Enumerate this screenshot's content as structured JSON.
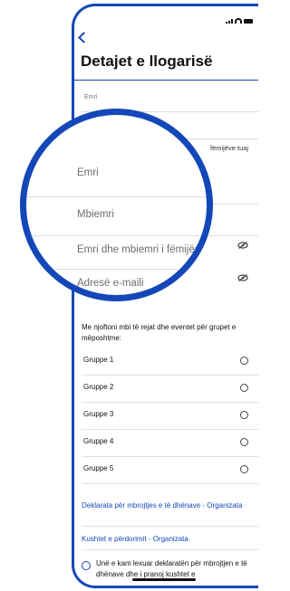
{
  "header": {
    "title": "Detajet e llogarisë"
  },
  "form": {
    "first_name": "Emri",
    "last_name": "Mbiemri",
    "children_fragment": "fëmijëve tuaj",
    "children_name": "Emri dhe mbiemri i fëmijës",
    "email": "Adresë e-maili"
  },
  "notify": {
    "text": "Me njoftoni mbi të rejat dhe eventet për grupet e mëposhtme:"
  },
  "groups": [
    "Gruppe 1",
    "Gruppe 2",
    "Gruppe 3",
    "Gruppe 4",
    "Gruppe 5"
  ],
  "links": {
    "privacy": "Deklarata për mbrojtjes e të dhënave - Organizata",
    "terms": "Kushtet e përdorimit - Organizata"
  },
  "consent": {
    "text": "Unë e kam lexuar deklaratën për mbrojtjen e të dhënave dhe i pranoj kushtet e"
  },
  "icons": {
    "back": "chevron-left-icon",
    "visibility": "eye-off-icon"
  },
  "colors": {
    "accent": "#1447b8"
  }
}
